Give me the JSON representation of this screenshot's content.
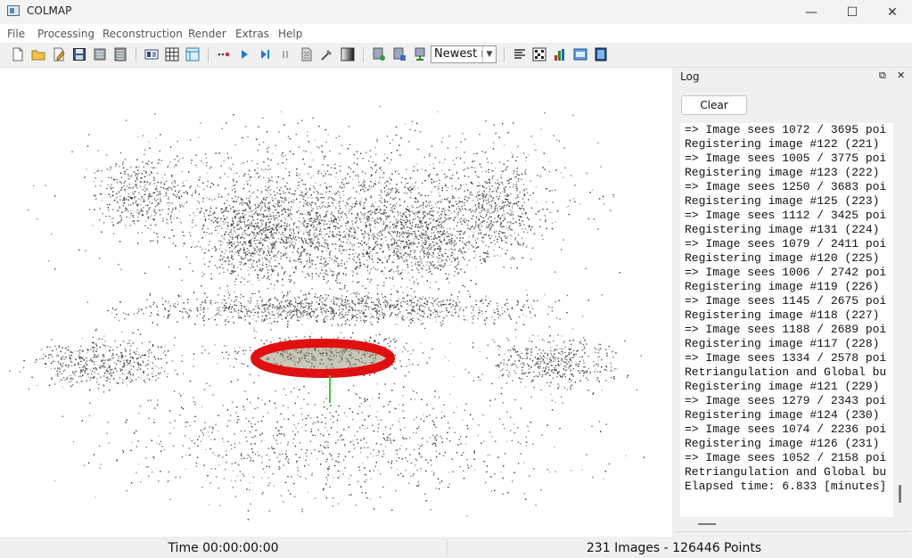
{
  "window": {
    "title": "COLMAP",
    "minimize_glyph": "—",
    "maximize_glyph": "☐",
    "close_glyph": "✕"
  },
  "menu": [
    "File",
    "Processing",
    "Reconstruction",
    "Render",
    "Extras",
    "Help"
  ],
  "toolbar": {
    "icons": [
      "new-project-icon",
      "open-project-icon",
      "edit-project-icon",
      "save-project-icon",
      "import-model-icon",
      "export-model-icon",
      "feature-extraction-icon",
      "feature-matching-icon",
      "database-management-icon",
      "reconstruction-start-icon",
      "reconstruction-step-icon",
      "reconstruction-pause-icon",
      "bundle-adjustment-icon",
      "dense-reconstruction-icon",
      "reset-view-icon",
      "grab-image-icon",
      "grab-movie-icon",
      "render-options-icon",
      "reconstruction-stats-icon",
      "match-matrix-icon",
      "grid-icon",
      "show-log-icon",
      "movie-icon"
    ],
    "reconstruction_select": "Newest r"
  },
  "log_dock": {
    "title": "Log",
    "float_glyph": "⧉",
    "close_glyph": "✕",
    "clear_label": "Clear",
    "lines": [
      "=> Image sees 1072 / 3695 poi",
      "Registering image #122 (221)",
      "=> Image sees 1005 / 3775 poi",
      "Registering image #123 (222)",
      "=> Image sees 1250 / 3683 poi",
      "Registering image #125 (223)",
      "=> Image sees 1112 / 3425 poi",
      "Registering image #131 (224)",
      "=> Image sees 1079 / 2411 poi",
      "Registering image #120 (225)",
      "=> Image sees 1006 / 2742 poi",
      "Registering image #119 (226)",
      "=> Image sees 1145 / 2675 poi",
      "Registering image #118 (227)",
      "=> Image sees 1188 / 2689 poi",
      "Registering image #117 (228)",
      "=> Image sees 1334 / 2578 poi",
      "Retriangulation and Global bu",
      "Registering image #121 (229)",
      "=> Image sees 1279 / 2343 poi",
      "Registering image #124 (230)",
      "=> Image sees 1074 / 2236 poi",
      "Registering image #126 (231)",
      "=> Image sees 1052 / 2158 poi",
      "Retriangulation and Global bu",
      "Elapsed time: 6.833 [minutes]"
    ]
  },
  "status": {
    "time": "Time 00:00:00:00",
    "summary": "231 Images - 126446 Points"
  },
  "colors": {
    "camera_ring": "#e01010",
    "axis_green": "#38c838",
    "points_dark": "#2e2e33",
    "points_mid": "#6f6f6f",
    "points_light": "#b6b6a8"
  }
}
